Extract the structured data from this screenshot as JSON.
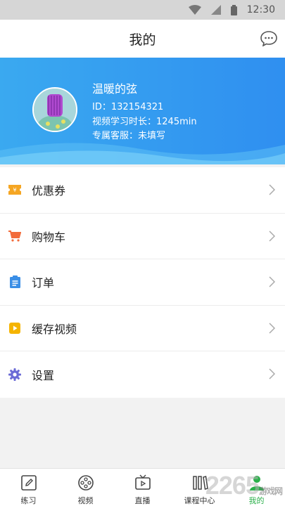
{
  "status": {
    "time": "12:30"
  },
  "header": {
    "title": "我的"
  },
  "profile": {
    "name": "温暖的弦",
    "id_line": "ID：132154321",
    "study_line": "视频学习时长：1245min",
    "service_line": "专属客服：未填写"
  },
  "menu": [
    {
      "label": "优惠券",
      "icon": "coupon-icon",
      "color": "#f5a623"
    },
    {
      "label": "购物车",
      "icon": "cart-icon",
      "color": "#f26b3a"
    },
    {
      "label": "订单",
      "icon": "order-icon",
      "color": "#3a8ee6"
    },
    {
      "label": "缓存视频",
      "icon": "play-icon",
      "color": "#f5b400"
    },
    {
      "label": "设置",
      "icon": "gear-icon",
      "color": "#6b6bd6"
    }
  ],
  "tabs": [
    {
      "label": "练习",
      "icon": "pencil-icon"
    },
    {
      "label": "视频",
      "icon": "film-reel-icon"
    },
    {
      "label": "直播",
      "icon": "tv-play-icon"
    },
    {
      "label": "课程中心",
      "icon": "books-icon"
    },
    {
      "label": "我的",
      "icon": "person-icon",
      "active": true
    }
  ],
  "watermark": {
    "text": "2265",
    "sub": "游戏网"
  },
  "colors": {
    "accent": "#2f8ff0",
    "active_tab": "#2bb04b"
  }
}
